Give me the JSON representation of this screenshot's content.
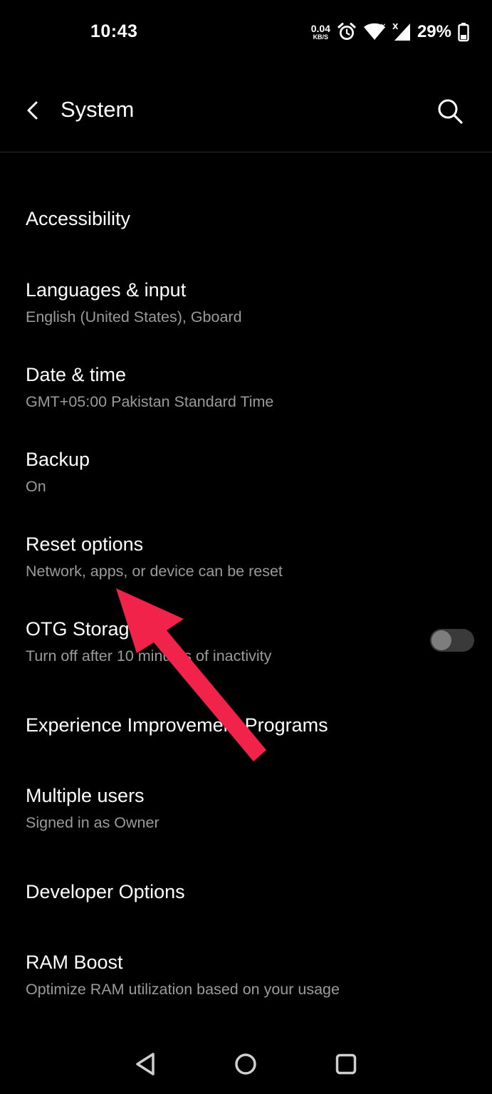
{
  "status_bar": {
    "time": "10:43",
    "net_speed_value": "0.04",
    "net_speed_unit": "KB/S",
    "battery_percent": "29%",
    "icons": [
      "alarm-icon",
      "wifi-icon",
      "cellular-signal-icon",
      "battery-icon"
    ]
  },
  "toolbar": {
    "title": "System",
    "back_icon": "chevron-left-icon",
    "search_icon": "search-icon"
  },
  "items": [
    {
      "title": "Accessibility",
      "subtitle": ""
    },
    {
      "title": "Languages & input",
      "subtitle": "English (United States), Gboard"
    },
    {
      "title": "Date & time",
      "subtitle": "GMT+05:00 Pakistan Standard Time"
    },
    {
      "title": "Backup",
      "subtitle": "On"
    },
    {
      "title": "Reset options",
      "subtitle": "Network, apps, or device can be reset"
    },
    {
      "title": "OTG Storage",
      "subtitle": "Turn off after 10 minutes of inactivity",
      "toggle": "off"
    },
    {
      "title": "Experience Improvement Programs",
      "subtitle": ""
    },
    {
      "title": "Multiple users",
      "subtitle": "Signed in as Owner"
    },
    {
      "title": "Developer Options",
      "subtitle": ""
    },
    {
      "title": "RAM Boost",
      "subtitle": "Optimize RAM utilization based on your usage"
    }
  ],
  "nav_bar": {
    "icons": [
      "back-triangle-icon",
      "home-circle-icon",
      "recents-square-icon"
    ]
  },
  "colors": {
    "background": "#000000",
    "text_primary": "#ffffff",
    "text_secondary": "#9b9b9b",
    "annotation_arrow": "#f2234a"
  }
}
